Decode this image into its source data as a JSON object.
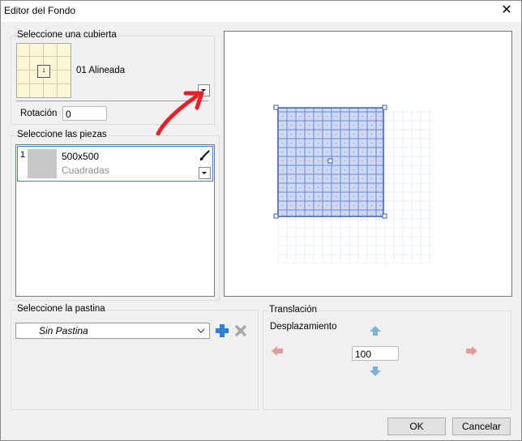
{
  "window": {
    "title": "Editor del Fondo",
    "close_glyph": "✕"
  },
  "cover": {
    "group_label": "Seleccione una cubierta",
    "tile_number": "1",
    "name": "01 Alineada",
    "rotation_label": "Rotación",
    "rotation_value": "0"
  },
  "pieces": {
    "group_label": "Seleccione las piezas",
    "items": [
      {
        "index": "1",
        "size": "500x500",
        "shape": "Cuadradas"
      }
    ]
  },
  "grout": {
    "group_label": "Seleccione la pastina",
    "selected": "Sin Pastina"
  },
  "translation": {
    "group_label": "Translación",
    "offset_label": "Desplazamiento",
    "offset_value": "100"
  },
  "buttons": {
    "ok": "OK",
    "cancel": "Cancelar"
  },
  "colors": {
    "accent_red": "#e8202a",
    "selection_blue": "#3c7fd8",
    "preview_fill": "#cfd9f3",
    "add_blue": "#2f7fd6"
  }
}
